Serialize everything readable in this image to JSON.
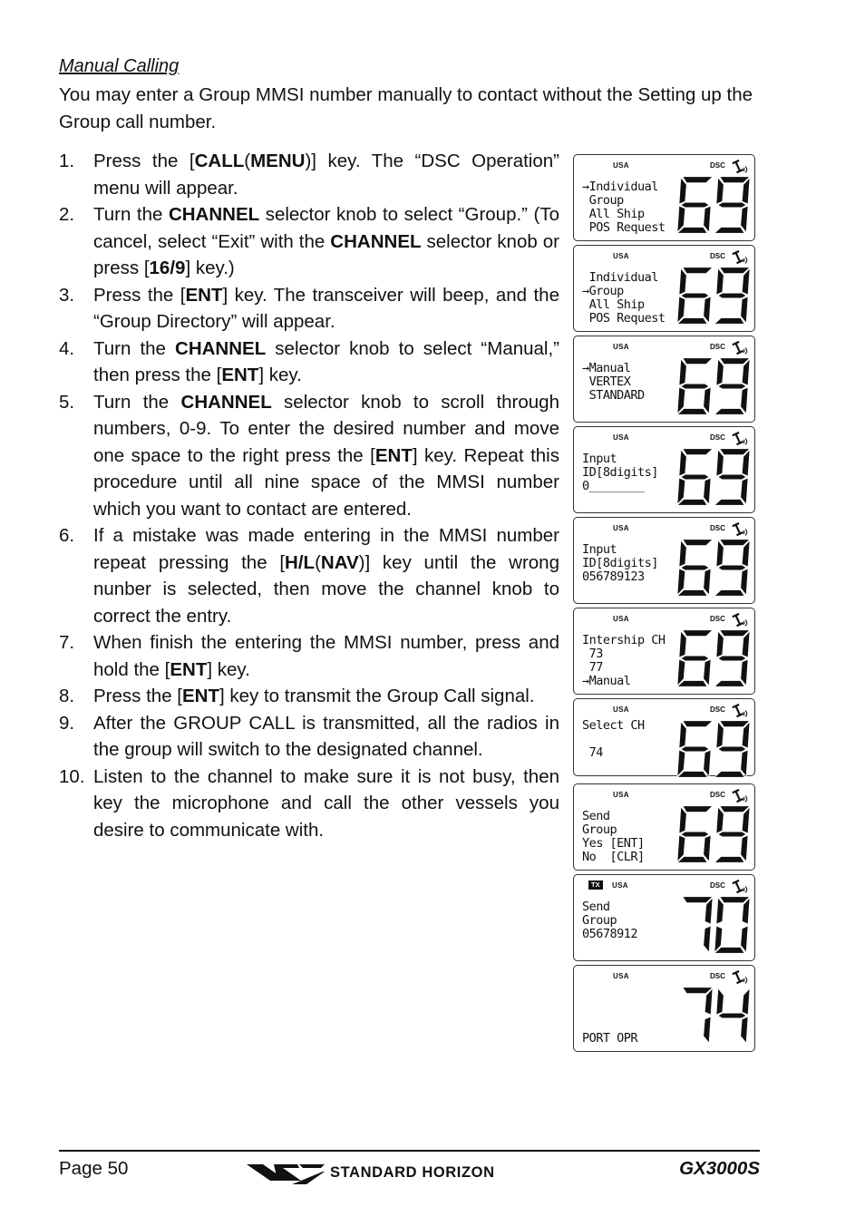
{
  "section": {
    "title": "Manual Calling",
    "intro": "You may enter a Group MMSI number manually to contact without the Setting up the Group call number."
  },
  "steps": [
    {
      "num": "1.",
      "parts": [
        [
          "t",
          "Press the ["
        ],
        [
          "b",
          "CALL"
        ],
        [
          "t",
          "("
        ],
        [
          "b",
          "MENU"
        ],
        [
          "t",
          ")] key. The “DSC Operation” menu will appear."
        ]
      ]
    },
    {
      "num": "2.",
      "parts": [
        [
          "t",
          "Turn the "
        ],
        [
          "b",
          "CHANNEL"
        ],
        [
          "t",
          " selector knob to select “Group.” (To cancel, select “Exit” with the "
        ],
        [
          "b",
          "CHANNEL"
        ],
        [
          "t",
          " selector knob or press ["
        ],
        [
          "b",
          "16/9"
        ],
        [
          "t",
          "] key.)"
        ]
      ]
    },
    {
      "num": "3.",
      "parts": [
        [
          "t",
          "Press the ["
        ],
        [
          "b",
          "ENT"
        ],
        [
          "t",
          "] key. The transceiver will beep, and the “Group Directory” will appear."
        ]
      ]
    },
    {
      "num": "4.",
      "parts": [
        [
          "t",
          "Turn the "
        ],
        [
          "b",
          "CHANNEL"
        ],
        [
          "t",
          " selector knob to select “Manual,” then press the ["
        ],
        [
          "b",
          "ENT"
        ],
        [
          "t",
          "] key."
        ]
      ]
    },
    {
      "num": "5.",
      "parts": [
        [
          "t",
          "Turn the "
        ],
        [
          "b",
          "CHANNEL"
        ],
        [
          "t",
          " selector knob to scroll through numbers, 0-9. To enter the desired number and move one space to the right press the ["
        ],
        [
          "b",
          "ENT"
        ],
        [
          "t",
          "] key. Repeat this procedure until all nine space of the MMSI number which you want to contact are entered."
        ]
      ]
    },
    {
      "num": "6.",
      "parts": [
        [
          "t",
          "If a mistake was made entering in the MMSI number repeat pressing the ["
        ],
        [
          "b",
          "H/L"
        ],
        [
          "t",
          "("
        ],
        [
          "b",
          "NAV"
        ],
        [
          "t",
          ")] key until the wrong nunber is selected, then move the channel knob to correct the entry."
        ]
      ]
    },
    {
      "num": "7.",
      "parts": [
        [
          "t",
          "When finish the entering the MMSI number, press and hold the ["
        ],
        [
          "b",
          "ENT"
        ],
        [
          "t",
          "] key."
        ]
      ]
    },
    {
      "num": "8.",
      "parts": [
        [
          "t",
          "Press the ["
        ],
        [
          "b",
          "ENT"
        ],
        [
          "t",
          "] key to transmit the Group Call signal."
        ]
      ]
    },
    {
      "num": "9.",
      "parts": [
        [
          "t",
          "After the GROUP CALL is transmitted, all the radios in the group will switch to the designated channel."
        ]
      ]
    },
    {
      "num": "10.",
      "parts": [
        [
          "t",
          "Listen to the channel to make sure it is not busy, then key the microphone and call the other vessels you desire to communicate with."
        ]
      ]
    }
  ],
  "lcd_screens": [
    {
      "tx": false,
      "region": "USA",
      "dsc": "DSC",
      "channel": "69",
      "lines": [
        "→Individual",
        " Group",
        " All Ship",
        " POS Request"
      ]
    },
    {
      "tx": false,
      "region": "USA",
      "dsc": "DSC",
      "channel": "69",
      "lines": [
        " Individual",
        "→Group",
        " All Ship",
        " POS Request"
      ]
    },
    {
      "tx": false,
      "region": "USA",
      "dsc": "DSC",
      "channel": "69",
      "lines": [
        "→Manual",
        " VERTEX",
        " STANDARD"
      ]
    },
    {
      "tx": false,
      "region": "USA",
      "dsc": "DSC",
      "channel": "69",
      "lines": [
        "Input",
        "ID[8digits]",
        "0________"
      ]
    },
    {
      "tx": false,
      "region": "USA",
      "dsc": "DSC",
      "channel": "69",
      "lines": [
        "Input",
        "ID[8digits]",
        "056789123"
      ]
    },
    {
      "tx": false,
      "region": "USA",
      "dsc": "DSC",
      "channel": "69",
      "lines": [
        "Intership CH",
        " 73",
        " 77",
        "→Manual"
      ]
    },
    {
      "tx": false,
      "region": "USA",
      "dsc": "DSC",
      "channel": "69",
      "lines": [
        "Select CH",
        "",
        " 74"
      ]
    },
    {
      "tx": false,
      "region": "USA",
      "dsc": "DSC",
      "channel": "69",
      "lines": [
        "Send",
        "Group",
        "Yes [ENT]",
        "No  [CLR]"
      ]
    },
    {
      "tx": true,
      "tx_label": "TX",
      "region": "USA",
      "dsc": "DSC",
      "channel": "70",
      "lines": [
        "Send",
        "Group",
        "05678912"
      ]
    },
    {
      "tx": false,
      "region": "USA",
      "dsc": "DSC",
      "channel": "74",
      "lines": [
        "",
        "",
        "",
        "PORT OPR"
      ]
    }
  ],
  "footer": {
    "page": "Page 50",
    "brand": "STANDARD HORIZON",
    "model": "GX3000S"
  }
}
